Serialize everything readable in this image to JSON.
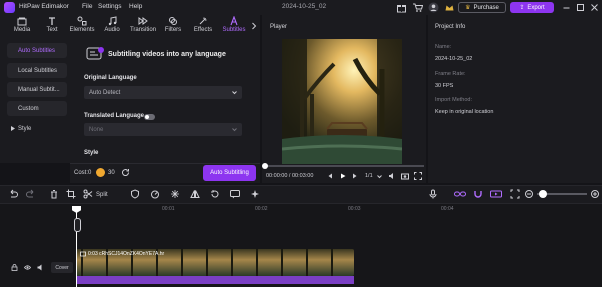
{
  "app": {
    "name": "HitPaw Edimakor",
    "menu": [
      "File",
      "Settings",
      "Help"
    ],
    "project_date": "2024-10-25_02"
  },
  "header": {
    "purchase_label": "Purchase",
    "export_label": "Export"
  },
  "toolbar": {
    "tabs": [
      "Media",
      "Text",
      "Elements",
      "Audio",
      "Transition",
      "Filters",
      "Effects",
      "Subtitles"
    ],
    "active_tab": "Subtitles"
  },
  "sidebar": {
    "items": [
      "Auto Subtitles",
      "Local Subtitles",
      "Manual Subtit...",
      "Custom",
      "Style"
    ],
    "active_item": "Auto Subtitles"
  },
  "subtitle_panel": {
    "heading": "Subtitling videos into any language",
    "original_language_label": "Original Language",
    "original_language_value": "Auto Detect",
    "translated_language_label": "Translated Language",
    "translated_language_value": "None",
    "translated_enabled": false,
    "style_label": "Style",
    "cost_label": "Cost:0",
    "coin_count": "30",
    "auto_button": "Auto Subtitling"
  },
  "player": {
    "title": "Player",
    "time": "00:00:00 / 00:03:00",
    "zoom": "1/1"
  },
  "project_info": {
    "title": "Project Info",
    "name_label": "Name:",
    "name_value": "2024-10-25_02",
    "frame_rate_label": "Frame Rate:",
    "frame_rate_value": "30 FPS",
    "import_method_label": "Import Method:",
    "import_method_value": "Keep in original location"
  },
  "timeline": {
    "split_label": "Split",
    "ruler": [
      "00",
      "00:01",
      "00:02",
      "00:03",
      "00:04"
    ],
    "clip_label": "0:03 cRhSCJ14OnZK4OnYE7A.hr",
    "cover_label": "Cover"
  },
  "colors": {
    "accent": "#8d35f0",
    "bg": "#141418",
    "panel": "#1b1b1f",
    "clip_bar": "#7a3fc4"
  }
}
